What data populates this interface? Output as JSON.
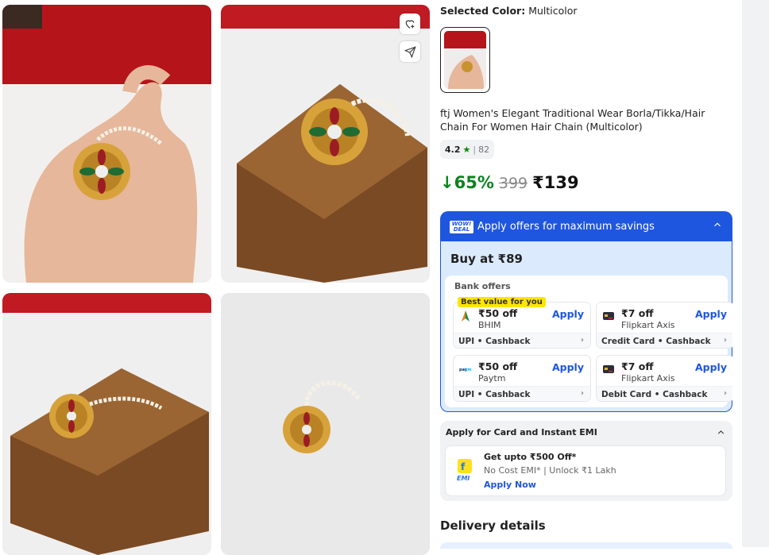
{
  "product": {
    "selected_color_label": "Selected Color:",
    "selected_color_value": "Multicolor",
    "title": "ftj Women's Elegant Traditional Wear Borla/Tikka/Hair Chain For Women Hair Chain (Multicolor)",
    "rating": "4.2",
    "rating_star": "★",
    "rating_sep": "|",
    "rating_count": "82",
    "discount": "↓65%",
    "mrp": "399",
    "price": "₹139"
  },
  "offers": {
    "header": "Apply offers for maximum savings",
    "wow_badge_line1": "WOW!",
    "wow_badge_line2": "DEAL",
    "buy_at": "Buy at ₹89",
    "bank_label": "Bank offers",
    "best_value": "Best value for you",
    "apply_label": "Apply",
    "items": [
      {
        "amount": "₹50 off",
        "provider": "BHIM",
        "footer": "UPI • Cashback",
        "icon": "bhim-icon"
      },
      {
        "amount": "₹7 off",
        "provider": "Flipkart Axis",
        "footer": "Credit Card • Cashback",
        "icon": "card-icon"
      },
      {
        "amount": "₹50 off",
        "provider": "Paytm",
        "footer": "UPI • Cashback",
        "icon": "paytm-icon"
      },
      {
        "amount": "₹7 off",
        "provider": "Flipkart Axis",
        "footer": "Debit Card • Cashback",
        "icon": "card-icon"
      }
    ]
  },
  "emi": {
    "header": "Apply for Card and Instant EMI",
    "line1": "Get upto ₹500 Off*",
    "line2": "No Cost EMI* | Unlock ₹1 Lakh",
    "cta": "Apply Now",
    "icon_label": "EMI"
  },
  "delivery": {
    "title": "Delivery details"
  },
  "colors": {
    "accent": "#1f56e0",
    "discount_green": "#0c831f",
    "best_value_bg": "#ffe500"
  }
}
